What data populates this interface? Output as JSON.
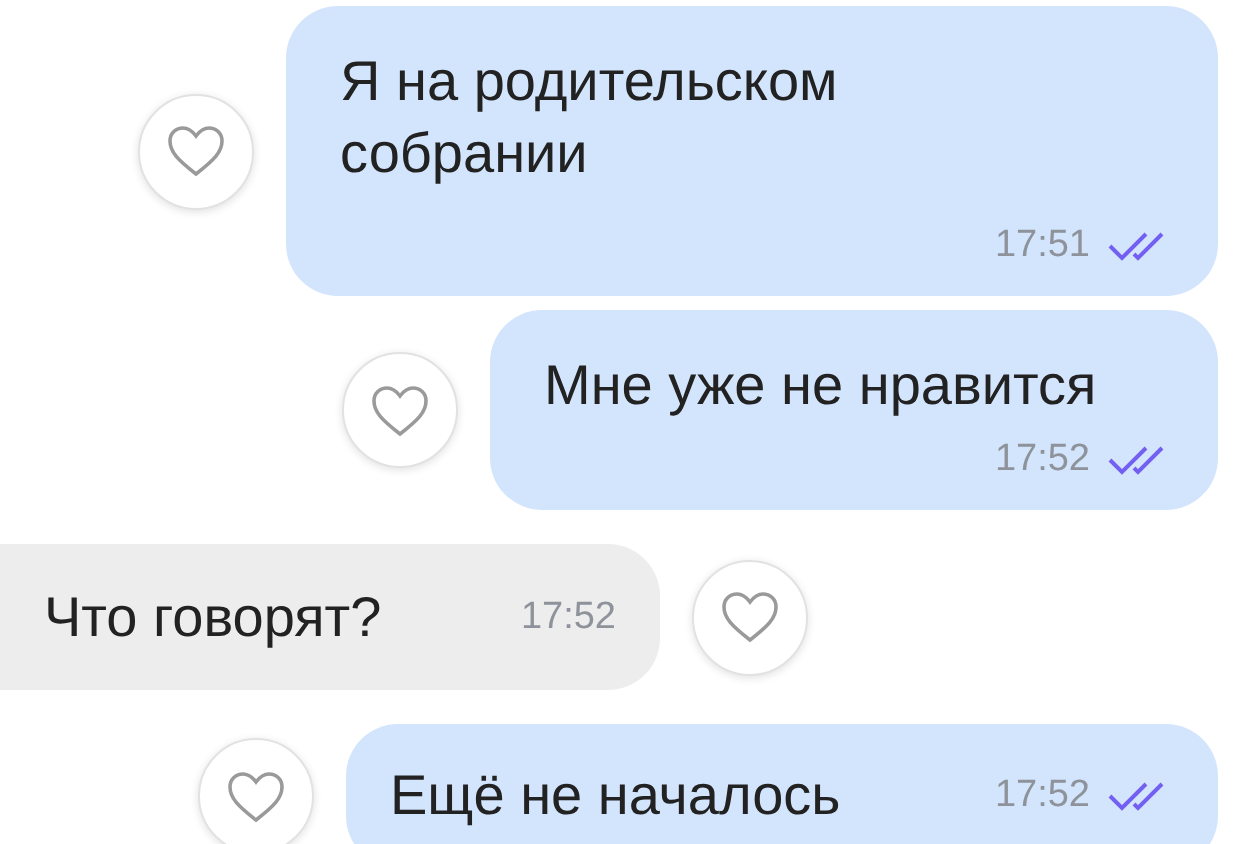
{
  "messages": [
    {
      "kind": "out",
      "text": "Я на родительском собрании",
      "time": "17:51",
      "read": true
    },
    {
      "kind": "out",
      "text": "Мне уже не нравится",
      "time": "17:52",
      "read": true
    },
    {
      "kind": "in",
      "text": "Что говорят?",
      "time": "17:52"
    },
    {
      "kind": "out",
      "text": "Ещё не началось",
      "time": "17:52",
      "read": true
    }
  ]
}
